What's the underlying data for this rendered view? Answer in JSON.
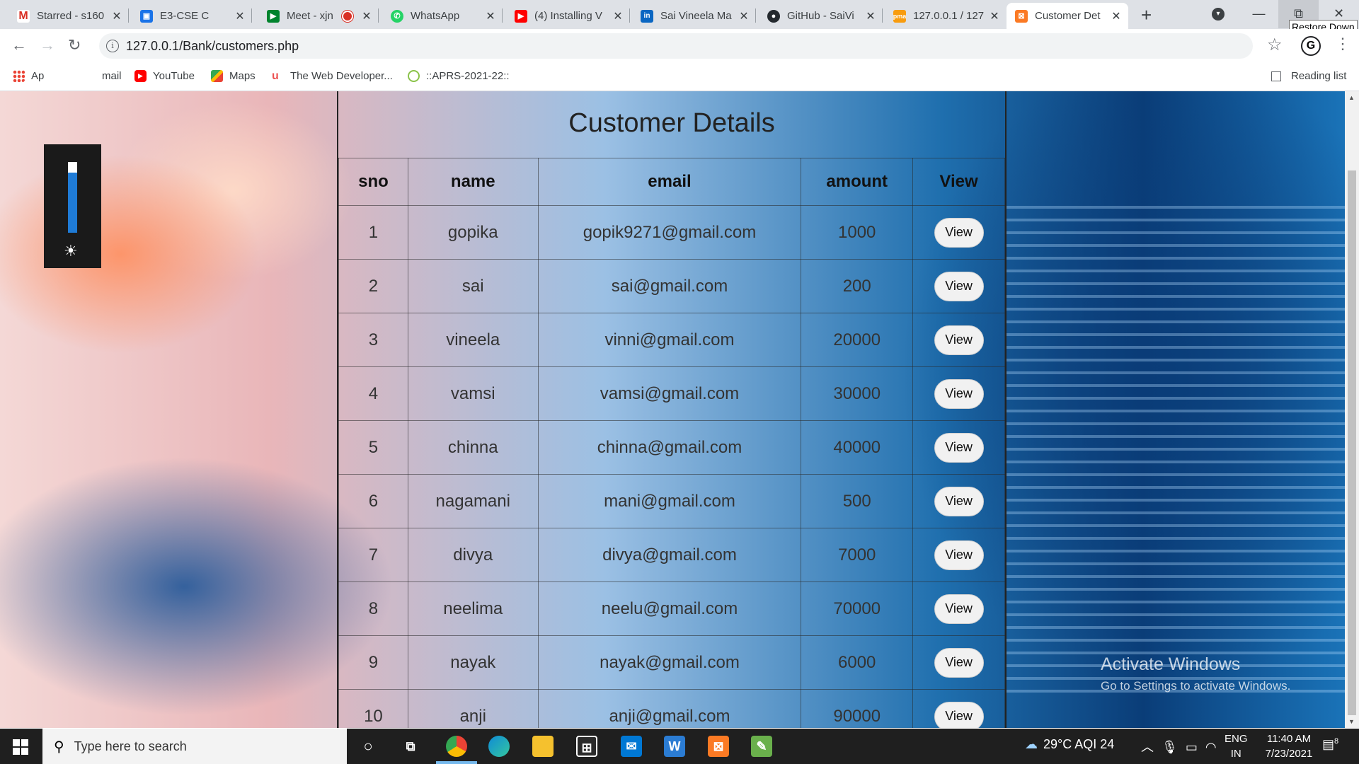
{
  "browser": {
    "tabs": [
      {
        "title": "Starred - s160",
        "icon": "gmail-icon",
        "color": "#d93025"
      },
      {
        "title": "E3-CSE C",
        "icon": "classroom-icon",
        "color": "#1a73e8"
      },
      {
        "title": "Meet - xjn",
        "icon": "meet-icon",
        "color": "#00832d"
      },
      {
        "title": "WhatsApp",
        "icon": "whatsapp-icon",
        "color": "#25d366"
      },
      {
        "title": "(4) Installing V",
        "icon": "youtube-icon",
        "color": "#ff0000"
      },
      {
        "title": "Sai Vineela Ma",
        "icon": "linkedin-icon",
        "color": "#0a66c2"
      },
      {
        "title": "GitHub - SaiVi",
        "icon": "github-icon",
        "color": "#24292e"
      },
      {
        "title": "127.0.0.1 / 127",
        "icon": "phpmyadmin-icon",
        "color": "#f89c0e"
      },
      {
        "title": "Customer Det",
        "icon": "xampp-icon",
        "color": "#fb7a24"
      }
    ],
    "tooltip": "Restore Down",
    "url": "127.0.0.1/Bank/customers.php",
    "bookmarks": [
      {
        "label": "Ap",
        "icon": "apps-grid-icon"
      },
      {
        "label": "mail",
        "icon": "gmail-icon"
      },
      {
        "label": "YouTube",
        "icon": "youtube-icon"
      },
      {
        "label": "Maps",
        "icon": "maps-icon"
      },
      {
        "label": "The Web Developer...",
        "icon": "udemy-icon"
      },
      {
        "label": "::APRS-2021-22::",
        "icon": "aprs-icon"
      }
    ],
    "reading_list": "Reading list"
  },
  "page": {
    "title": "Customer Details",
    "columns": [
      "sno",
      "name",
      "email",
      "amount",
      "View"
    ],
    "view_label": "View",
    "customers": [
      {
        "sno": "1",
        "name": "gopika",
        "email": "gopik9271@gmail.com",
        "amount": "1000"
      },
      {
        "sno": "2",
        "name": "sai",
        "email": "sai@gmail.com",
        "amount": "200"
      },
      {
        "sno": "3",
        "name": "vineela",
        "email": "vinni@gmail.com",
        "amount": "20000"
      },
      {
        "sno": "4",
        "name": "vamsi",
        "email": "vamsi@gmail.com",
        "amount": "30000"
      },
      {
        "sno": "5",
        "name": "chinna",
        "email": "chinna@gmail.com",
        "amount": "40000"
      },
      {
        "sno": "6",
        "name": "nagamani",
        "email": "mani@gmail.com",
        "amount": "500"
      },
      {
        "sno": "7",
        "name": "divya",
        "email": "divya@gmail.com",
        "amount": "7000"
      },
      {
        "sno": "8",
        "name": "neelima",
        "email": "neelu@gmail.com",
        "amount": "70000"
      },
      {
        "sno": "9",
        "name": "nayak",
        "email": "nayak@gmail.com",
        "amount": "6000"
      },
      {
        "sno": "10",
        "name": "anji",
        "email": "anji@gmail.com",
        "amount": "90000"
      }
    ]
  },
  "brightness_level": 0.85,
  "watermark": {
    "line1": "Activate Windows",
    "line2": "Go to Settings to activate Windows."
  },
  "taskbar": {
    "search_placeholder": "Type here to search",
    "weather": "29°C  AQI 24",
    "language": "ENG",
    "region": "IN",
    "time": "11:40 AM",
    "date": "7/23/2021",
    "notifications": "8"
  }
}
